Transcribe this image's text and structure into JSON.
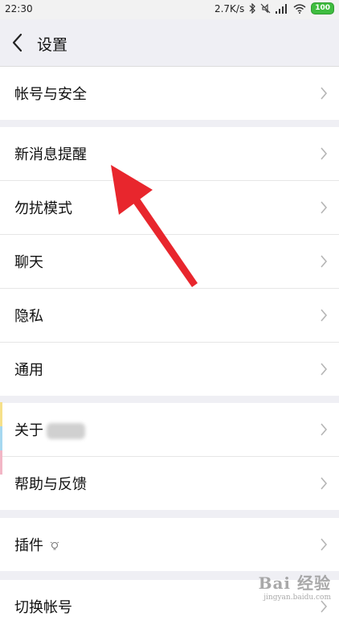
{
  "status_bar": {
    "time": "22:30",
    "net_speed": "2.7K/s",
    "battery": "100",
    "icons": [
      "bluetooth-icon",
      "mute-icon",
      "signal-icon",
      "wifi-icon",
      "battery-icon"
    ]
  },
  "header": {
    "back_icon": "chevron-left-icon",
    "title": "设置"
  },
  "groups": [
    {
      "items": [
        {
          "label": "帐号与安全"
        }
      ]
    },
    {
      "items": [
        {
          "label": "新消息提醒"
        },
        {
          "label": "勿扰模式"
        },
        {
          "label": "聊天"
        },
        {
          "label": "隐私"
        },
        {
          "label": "通用"
        }
      ]
    },
    {
      "items": [
        {
          "label": "关于"
        },
        {
          "label": "帮助与反馈"
        }
      ]
    },
    {
      "items": [
        {
          "label": "插件"
        }
      ]
    },
    {
      "items": [
        {
          "label": "切换帐号"
        }
      ]
    }
  ],
  "annotation": {
    "arrow_color": "#e8262d",
    "target": "新消息提醒"
  },
  "watermark": {
    "brand": "Bai 经验",
    "url": "jingyan.baidu.com"
  },
  "colors": {
    "background": "#efeff4",
    "card": "#ffffff",
    "chevron": "#b5b5b5"
  }
}
